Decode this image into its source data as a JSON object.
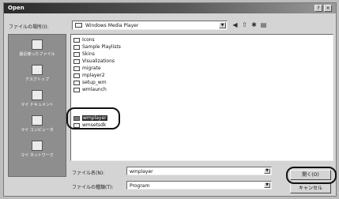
{
  "window": {
    "title": "Open"
  },
  "titlebar_buttons": [
    "?",
    "×"
  ],
  "lookin": {
    "label": "ファイルの場所(I):",
    "value": "Windows Media Player"
  },
  "toolbar_icons": [
    "back-icon",
    "up-folder-icon",
    "new-folder-icon",
    "view-menu-icon"
  ],
  "places": [
    {
      "label": "最近使ったファイル",
      "icon": "recent-icon"
    },
    {
      "label": "デスクトップ",
      "icon": "desktop-icon"
    },
    {
      "label": "マイ ドキュメント",
      "icon": "my-documents-icon"
    },
    {
      "label": "マイ コンピュータ",
      "icon": "my-computer-icon"
    },
    {
      "label": "マイ ネットワーク",
      "icon": "my-network-icon"
    }
  ],
  "files": [
    {
      "name": "Icons",
      "type": "folder"
    },
    {
      "name": "Sample Playlists",
      "type": "folder"
    },
    {
      "name": "Skins",
      "type": "folder"
    },
    {
      "name": "Visualizations",
      "type": "folder"
    },
    {
      "name": "migrate",
      "type": "file"
    },
    {
      "name": "mplayer2",
      "type": "file"
    },
    {
      "name": "setup_wm",
      "type": "file"
    },
    {
      "name": "wmlaunch",
      "type": "file"
    },
    {
      "name": "wmplayer",
      "type": "app",
      "selected": true
    },
    {
      "name": "wmsetsdk",
      "type": "file"
    }
  ],
  "filename": {
    "label": "ファイル名(N):",
    "value": "wmplayer"
  },
  "filetype": {
    "label": "ファイルの種類(T):",
    "value": "Program"
  },
  "buttons": {
    "open": "開く(O)",
    "cancel": "キャンセル"
  }
}
